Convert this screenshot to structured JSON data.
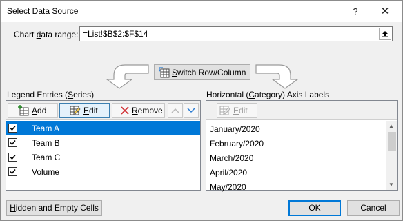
{
  "window": {
    "title": "Select Data Source",
    "help_glyph": "?",
    "close_glyph": "✕"
  },
  "range": {
    "label": "Chart data range:",
    "value": "=List!$B$2:$F$14"
  },
  "switch": {
    "label": "Switch Row/Column"
  },
  "legend": {
    "heading": "Legend Entries (Series)",
    "add_label": "Add",
    "edit_label": "Edit",
    "remove_label": "Remove",
    "items": [
      {
        "label": "Team A",
        "checked": true,
        "selected": true
      },
      {
        "label": "Team B",
        "checked": true,
        "selected": false
      },
      {
        "label": "Team C",
        "checked": true,
        "selected": false
      },
      {
        "label": "Volume",
        "checked": true,
        "selected": false
      }
    ]
  },
  "axis": {
    "heading": "Horizontal (Category) Axis Labels",
    "edit_label": "Edit",
    "items": [
      "January/2020",
      "February/2020",
      "March/2020",
      "April/2020",
      "May/2020"
    ]
  },
  "buttons": {
    "hidden_cells": "Hidden and Empty Cells",
    "ok": "OK",
    "cancel": "Cancel"
  },
  "colors": {
    "selection": "#0078d7",
    "dialog_bg": "#f0f0f0",
    "remove_icon": "#d13438",
    "arrow_icon": "#2b7cd3"
  }
}
